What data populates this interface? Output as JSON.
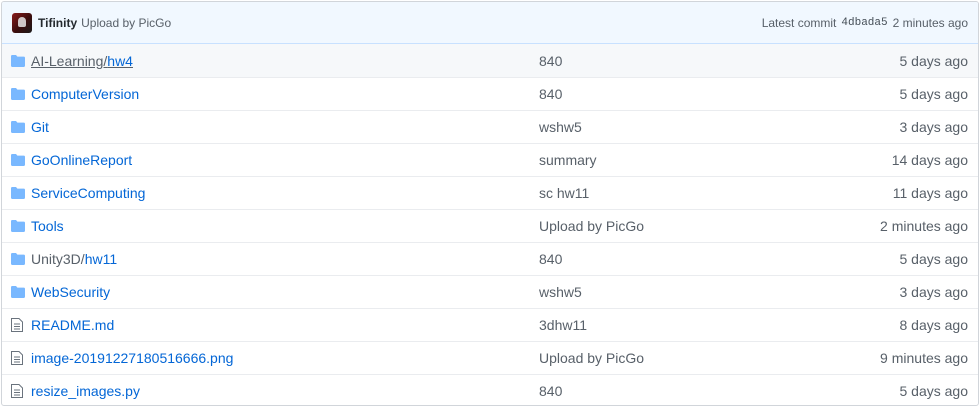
{
  "commit_bar": {
    "author": "Tifinity",
    "message": "Upload by PicGo",
    "latest_label": "Latest commit",
    "sha": "4dbada5",
    "age": "2 minutes ago"
  },
  "colors": {
    "link": "#0366d6",
    "muted": "#586069",
    "folder_icon": "#79b8ff",
    "commit_bar_bg": "#f1f8ff"
  },
  "rows": [
    {
      "type": "folder",
      "icon": "folder-icon",
      "name_a": "AI-Learning/",
      "name_b": "hw4",
      "message": "840",
      "age": "5 days ago"
    },
    {
      "type": "folder",
      "icon": "folder-icon",
      "name": "ComputerVersion",
      "message": "840",
      "age": "5 days ago"
    },
    {
      "type": "folder",
      "icon": "folder-icon",
      "name": "Git",
      "message": "wshw5",
      "age": "3 days ago"
    },
    {
      "type": "folder",
      "icon": "folder-icon",
      "name": "GoOnlineReport",
      "message": "summary",
      "age": "14 days ago"
    },
    {
      "type": "folder",
      "icon": "folder-icon",
      "name": "ServiceComputing",
      "message": "sc hw11",
      "age": "11 days ago"
    },
    {
      "type": "folder",
      "icon": "folder-icon",
      "name": "Tools",
      "message": "Upload by PicGo",
      "age": "2 minutes ago"
    },
    {
      "type": "folder",
      "icon": "folder-icon",
      "name_a": "Unity3D/",
      "name_b": "hw11",
      "message": "840",
      "age": "5 days ago"
    },
    {
      "type": "folder",
      "icon": "folder-icon",
      "name": "WebSecurity",
      "message": "wshw5",
      "age": "3 days ago"
    },
    {
      "type": "file",
      "icon": "file-icon",
      "name": "README.md",
      "message": "3dhw11",
      "age": "8 days ago"
    },
    {
      "type": "file",
      "icon": "file-icon",
      "name": "image-20191227180516666.png",
      "message": "Upload by PicGo",
      "age": "9 minutes ago"
    },
    {
      "type": "file",
      "icon": "file-icon",
      "name": "resize_images.py",
      "message": "840",
      "age": "5 days ago"
    }
  ]
}
